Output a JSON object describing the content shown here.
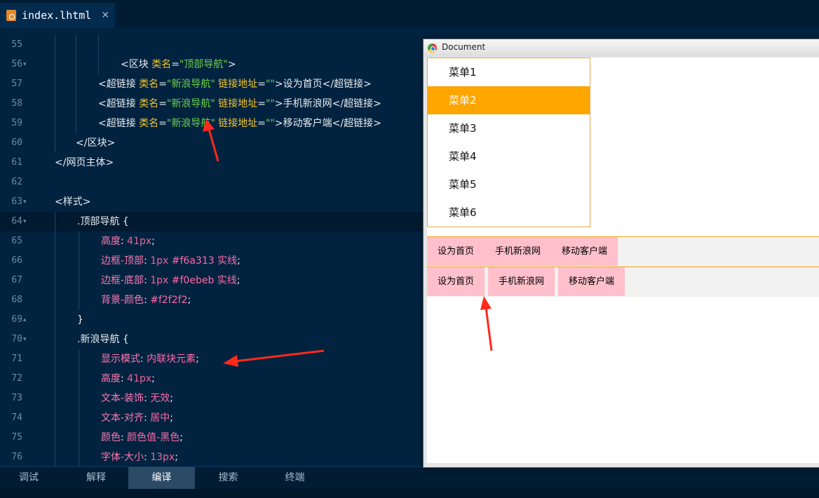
{
  "tab": {
    "title": "index.lhtml",
    "close": "✕"
  },
  "editor": {
    "lines": [
      {
        "num": "55",
        "fold": "",
        "parts": []
      },
      {
        "num": "56",
        "fold": "▾",
        "parts": [
          [
            "tg",
            "<区块 "
          ],
          [
            "at",
            "类名"
          ],
          [
            "tg",
            "="
          ],
          [
            "st",
            "\"顶部导航\""
          ],
          [
            "tg",
            ">"
          ]
        ]
      },
      {
        "num": "57",
        "fold": "",
        "parts": [
          [
            "tg",
            "<超链接 "
          ],
          [
            "at",
            "类名"
          ],
          [
            "tg",
            "="
          ],
          [
            "st",
            "\"新浪导航\""
          ],
          [
            "tg",
            " "
          ],
          [
            "at",
            "链接地址"
          ],
          [
            "tg",
            "="
          ],
          [
            "st",
            "\"\""
          ],
          [
            "tg",
            ">设为首页</超链接>"
          ]
        ]
      },
      {
        "num": "58",
        "fold": "",
        "parts": [
          [
            "tg",
            "<超链接 "
          ],
          [
            "at",
            "类名"
          ],
          [
            "tg",
            "="
          ],
          [
            "st",
            "\"新浪导航\""
          ],
          [
            "tg",
            " "
          ],
          [
            "at",
            "链接地址"
          ],
          [
            "tg",
            "="
          ],
          [
            "st",
            "\"\""
          ],
          [
            "tg",
            ">手机新浪网</超链接>"
          ]
        ]
      },
      {
        "num": "59",
        "fold": "",
        "parts": [
          [
            "tg",
            "<超链接 "
          ],
          [
            "at",
            "类名"
          ],
          [
            "tg",
            "="
          ],
          [
            "st",
            "\"新浪导航\""
          ],
          [
            "tg",
            " "
          ],
          [
            "at",
            "链接地址"
          ],
          [
            "tg",
            "="
          ],
          [
            "st",
            "\"\""
          ],
          [
            "tg",
            ">移动客户端</超链接>"
          ]
        ]
      },
      {
        "num": "60",
        "fold": "",
        "parts": [
          [
            "tg",
            "</区块>"
          ]
        ]
      },
      {
        "num": "61",
        "fold": "",
        "parts": [
          [
            "tg",
            "</网页主体>"
          ]
        ]
      },
      {
        "num": "62",
        "fold": "",
        "parts": []
      },
      {
        "num": "63",
        "fold": "▾",
        "parts": [
          [
            "tg",
            "<样式>"
          ]
        ]
      },
      {
        "num": "64",
        "fold": "▾",
        "parts": [
          [
            "cl",
            ".顶部导航 "
          ],
          [
            "cl",
            "{"
          ]
        ]
      },
      {
        "num": "65",
        "fold": "",
        "parts": [
          [
            "pk",
            "高度"
          ],
          [
            "vl",
            ": "
          ],
          [
            "nm",
            "41px"
          ],
          [
            "vl",
            ";"
          ]
        ]
      },
      {
        "num": "66",
        "fold": "",
        "parts": [
          [
            "pk",
            "边框-顶部"
          ],
          [
            "vl",
            ": "
          ],
          [
            "nm",
            "1px "
          ],
          [
            "kw",
            "#f6a313"
          ],
          [
            "vl",
            " "
          ],
          [
            "kw",
            "实线"
          ],
          [
            "vl",
            ";"
          ]
        ]
      },
      {
        "num": "67",
        "fold": "",
        "parts": [
          [
            "pk",
            "边框-底部"
          ],
          [
            "vl",
            ": "
          ],
          [
            "nm",
            "1px "
          ],
          [
            "kw",
            "#f0ebeb"
          ],
          [
            "vl",
            " "
          ],
          [
            "kw",
            "实线"
          ],
          [
            "vl",
            ";"
          ]
        ]
      },
      {
        "num": "68",
        "fold": "",
        "parts": [
          [
            "pk",
            "背景-颜色"
          ],
          [
            "vl",
            ": "
          ],
          [
            "kw",
            "#f2f2f2"
          ],
          [
            "vl",
            ";"
          ]
        ]
      },
      {
        "num": "69",
        "fold": "▴",
        "parts": [
          [
            "cl",
            "}"
          ]
        ]
      },
      {
        "num": "70",
        "fold": "▾",
        "parts": [
          [
            "cl",
            ".新浪导航 {"
          ]
        ]
      },
      {
        "num": "71",
        "fold": "",
        "parts": [
          [
            "pk",
            "显示模式"
          ],
          [
            "vl",
            ": "
          ],
          [
            "kw",
            "内联块元素"
          ],
          [
            "vl",
            ";"
          ]
        ]
      },
      {
        "num": "72",
        "fold": "",
        "parts": [
          [
            "pk",
            "高度"
          ],
          [
            "vl",
            ": "
          ],
          [
            "nm",
            "41px"
          ],
          [
            "vl",
            ";"
          ]
        ]
      },
      {
        "num": "73",
        "fold": "",
        "parts": [
          [
            "pk",
            "文本-装饰"
          ],
          [
            "vl",
            ": "
          ],
          [
            "kw",
            "无效"
          ],
          [
            "vl",
            ";"
          ]
        ]
      },
      {
        "num": "74",
        "fold": "",
        "parts": [
          [
            "pk",
            "文本-对齐"
          ],
          [
            "vl",
            ": "
          ],
          [
            "kw",
            "居中"
          ],
          [
            "vl",
            ";"
          ]
        ]
      },
      {
        "num": "75",
        "fold": "",
        "parts": [
          [
            "pk",
            "颜色"
          ],
          [
            "vl",
            ": "
          ],
          [
            "kw",
            "颜色值-黑色"
          ],
          [
            "vl",
            ";"
          ]
        ]
      },
      {
        "num": "76",
        "fold": "",
        "parts": [
          [
            "pk",
            "字体-大小"
          ],
          [
            "vl",
            ": "
          ],
          [
            "nm",
            "13px"
          ],
          [
            "vl",
            ";"
          ]
        ]
      }
    ]
  },
  "bottom_tabs": [
    "调试",
    "解释",
    "编译",
    "搜索",
    "终端"
  ],
  "bottom_active": "编译",
  "browser": {
    "title": "Document",
    "menu": [
      "菜单1",
      "菜单2",
      "菜单3",
      "菜单4",
      "菜单5",
      "菜单6"
    ],
    "selected_menu": "菜单2",
    "nav1": [
      "设为首页",
      "手机新浪网",
      "移动客户端"
    ],
    "nav2": [
      "设为首页",
      "手机新浪网",
      "移动客户端"
    ]
  },
  "colors": {
    "accent": "#ffa500",
    "nav_link": "#ffc0cb",
    "nav_border_top": "#f6a313",
    "editor_bg": "#012340",
    "arrow": "#ff2a1a"
  }
}
